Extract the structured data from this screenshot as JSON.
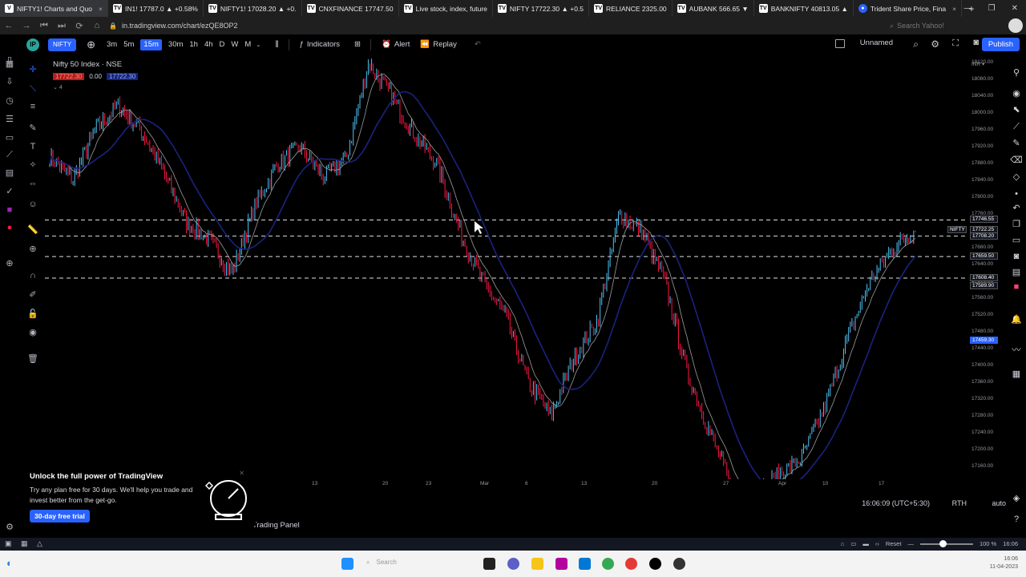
{
  "browser": {
    "tabs": [
      {
        "label": "NIFTY1! Charts and Quo",
        "icon": "tv-icon"
      },
      {
        "label": "IN1! 17787.0 ▲ +0.58%",
        "icon": "tv-icon"
      },
      {
        "label": "NIFTY1! 17028.20 ▲ +0.",
        "icon": "tv-icon"
      },
      {
        "label": "CNXFINANCE 17747.50",
        "icon": "tv-icon"
      },
      {
        "label": "Live stock, index, future",
        "icon": "tv-icon"
      },
      {
        "label": "NIFTY 17722.30 ▲ +0.5",
        "icon": "tv-icon"
      },
      {
        "label": "RELIANCE 2325.00",
        "icon": "tv-icon"
      },
      {
        "label": "AUBANK 566.65 ▼",
        "icon": "tv-icon"
      },
      {
        "label": "BANKNIFTY 40813.05 ▲",
        "icon": "tv-icon"
      },
      {
        "label": "Trident Share Price, Fina",
        "icon": "globe-icon"
      }
    ],
    "url": "in.tradingview.com/chart/ezQE8OP2",
    "search_placeholder": "Search Yahoo!"
  },
  "toolbar": {
    "symbol": "NIFTY",
    "intervals": [
      "3m",
      "5m",
      "15m",
      "30m",
      "1h",
      "4h",
      "D",
      "W",
      "M"
    ],
    "selected_interval": "15m",
    "indicators_label": "Indicators",
    "alert_label": "Alert",
    "replay_label": "Replay",
    "layout_name": "Unnamed",
    "publish_label": "Publish"
  },
  "legend": {
    "title": "Nifty 50 Index · NSE",
    "price_badge": "17722.30",
    "change": "0.00",
    "price_badge_2": "17722.30",
    "indicator_count": "4"
  },
  "price_scale": {
    "labels": [
      "18120.00",
      "18080.00",
      "18040.00",
      "18000.00",
      "17960.00",
      "17920.00",
      "17880.00",
      "17840.00",
      "17800.00",
      "17760.00",
      "17720.00",
      "17680.00",
      "17640.00",
      "17600.00",
      "17560.00",
      "17520.00",
      "17480.00",
      "17440.00",
      "17400.00",
      "17360.00",
      "17320.00",
      "17280.00",
      "17240.00",
      "17200.00",
      "17160.00"
    ],
    "tags": [
      {
        "text": "17746.55",
        "style": "dark"
      },
      {
        "text": "17722.25",
        "style": "dark"
      },
      {
        "text": "17708.20",
        "style": "dark"
      },
      {
        "text": "17659.50",
        "style": "dark"
      },
      {
        "text": "17608.40",
        "style": "dark"
      },
      {
        "text": "17589.90",
        "style": "dark"
      },
      {
        "text": "17459.30",
        "style": "blue"
      }
    ],
    "symbol_tag": "NIFTY"
  },
  "time_axis": [
    "6",
    "13",
    "20",
    "23",
    "Mar",
    "6",
    "13",
    "20",
    "27",
    "Apr",
    "10",
    "17"
  ],
  "status": {
    "clock": "16:06:09 (UTC+5:30)",
    "session": "RTH",
    "scale": "auto",
    "panel": "Trading Panel"
  },
  "promo": {
    "title": "Unlock the full power of TradingView",
    "body": "Try any plan free for 30 days. We'll help you trade and invest better from the get-go.",
    "cta": "30-day free trial"
  },
  "bottom": {
    "reset": "Reset",
    "zoom": "100 %",
    "time": "16:06"
  },
  "taskbar": {
    "search": "Search",
    "time": "16:06",
    "date": "11-04-2023"
  },
  "colors": {
    "accent": "#2962ff",
    "up_candle": "#4fc3f7",
    "down_candle": "#ff1744",
    "ma_line": "#1a237e",
    "ma_line_2": "#9e9e9e"
  },
  "chart_data": {
    "type": "candlestick",
    "symbol": "Nifty 50 Index · NSE",
    "interval": "15m",
    "ylim": [
      17130,
      18140
    ],
    "horizontal_levels": [
      17746.55,
      17708.2,
      17659.5,
      17608.4
    ],
    "series_trend_close": [
      17900,
      17840,
      17960,
      18020,
      17960,
      17860,
      17740,
      17700,
      17620,
      17780,
      17880,
      17920,
      17850,
      17890,
      18120,
      18040,
      17950,
      17880,
      17720,
      17600,
      17520,
      17360,
      17280,
      17420,
      17500,
      17760,
      17720,
      17600,
      17380,
      17240,
      17100,
      17090,
      17140,
      17180,
      17300,
      17460,
      17600,
      17680,
      17722.3
    ]
  }
}
